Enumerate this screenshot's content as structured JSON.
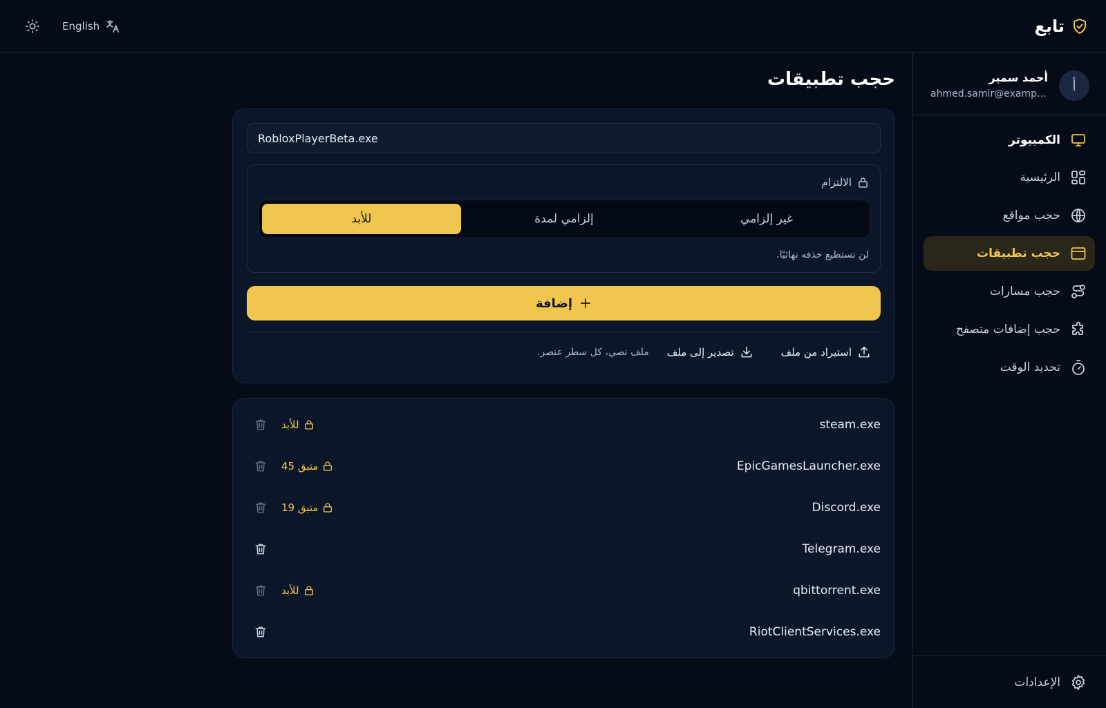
{
  "topbar": {
    "language_label": "English",
    "brand_name": "تابع"
  },
  "user": {
    "avatar_initial": "أ",
    "name": "أحمد سمير",
    "email": "ahmed.samir@example.com"
  },
  "sidebar": {
    "group_label": "الكمبيوتر",
    "items": [
      {
        "label": "الرئيسية",
        "icon": "dashboard-icon"
      },
      {
        "label": "حجب مواقع",
        "icon": "globe-icon"
      },
      {
        "label": "حجب تطبيقات",
        "icon": "app-window-icon",
        "active": true
      },
      {
        "label": "حجب مسارات",
        "icon": "route-icon"
      },
      {
        "label": "حجب إضافات متصفح",
        "icon": "puzzle-icon"
      },
      {
        "label": "تحديد الوقت",
        "icon": "timer-icon"
      }
    ],
    "settings_label": "الإعدادات"
  },
  "main": {
    "title": "حجب تطبيقات",
    "input_value": "RobloxPlayerBeta.exe",
    "commitment": {
      "label": "الالتزام",
      "options": [
        "غير إلزامي",
        "إلزامي لمدة",
        "للأبد"
      ],
      "selected": "للأبد",
      "hint": "لن تستطيع حذفه نهائيًا."
    },
    "add_label": "إضافة",
    "import_label": "استيراد من ملف",
    "export_label": "تصدير إلى ملف",
    "file_hint": "ملف نصي، كل سطر عنصر."
  },
  "apps": [
    {
      "name": "steam.exe",
      "badge": "للأبد"
    },
    {
      "name": "EpicGamesLauncher.exe",
      "badge": "متبق 45"
    },
    {
      "name": "Discord.exe",
      "badge": "متبق 19"
    },
    {
      "name": "Telegram.exe",
      "badge": ""
    },
    {
      "name": "qbittorrent.exe",
      "badge": "للأبد"
    },
    {
      "name": "RiotClientServices.exe",
      "badge": ""
    }
  ],
  "colors": {
    "accent": "#f0c64f",
    "background": "#050b17",
    "card": "#0c1629"
  }
}
